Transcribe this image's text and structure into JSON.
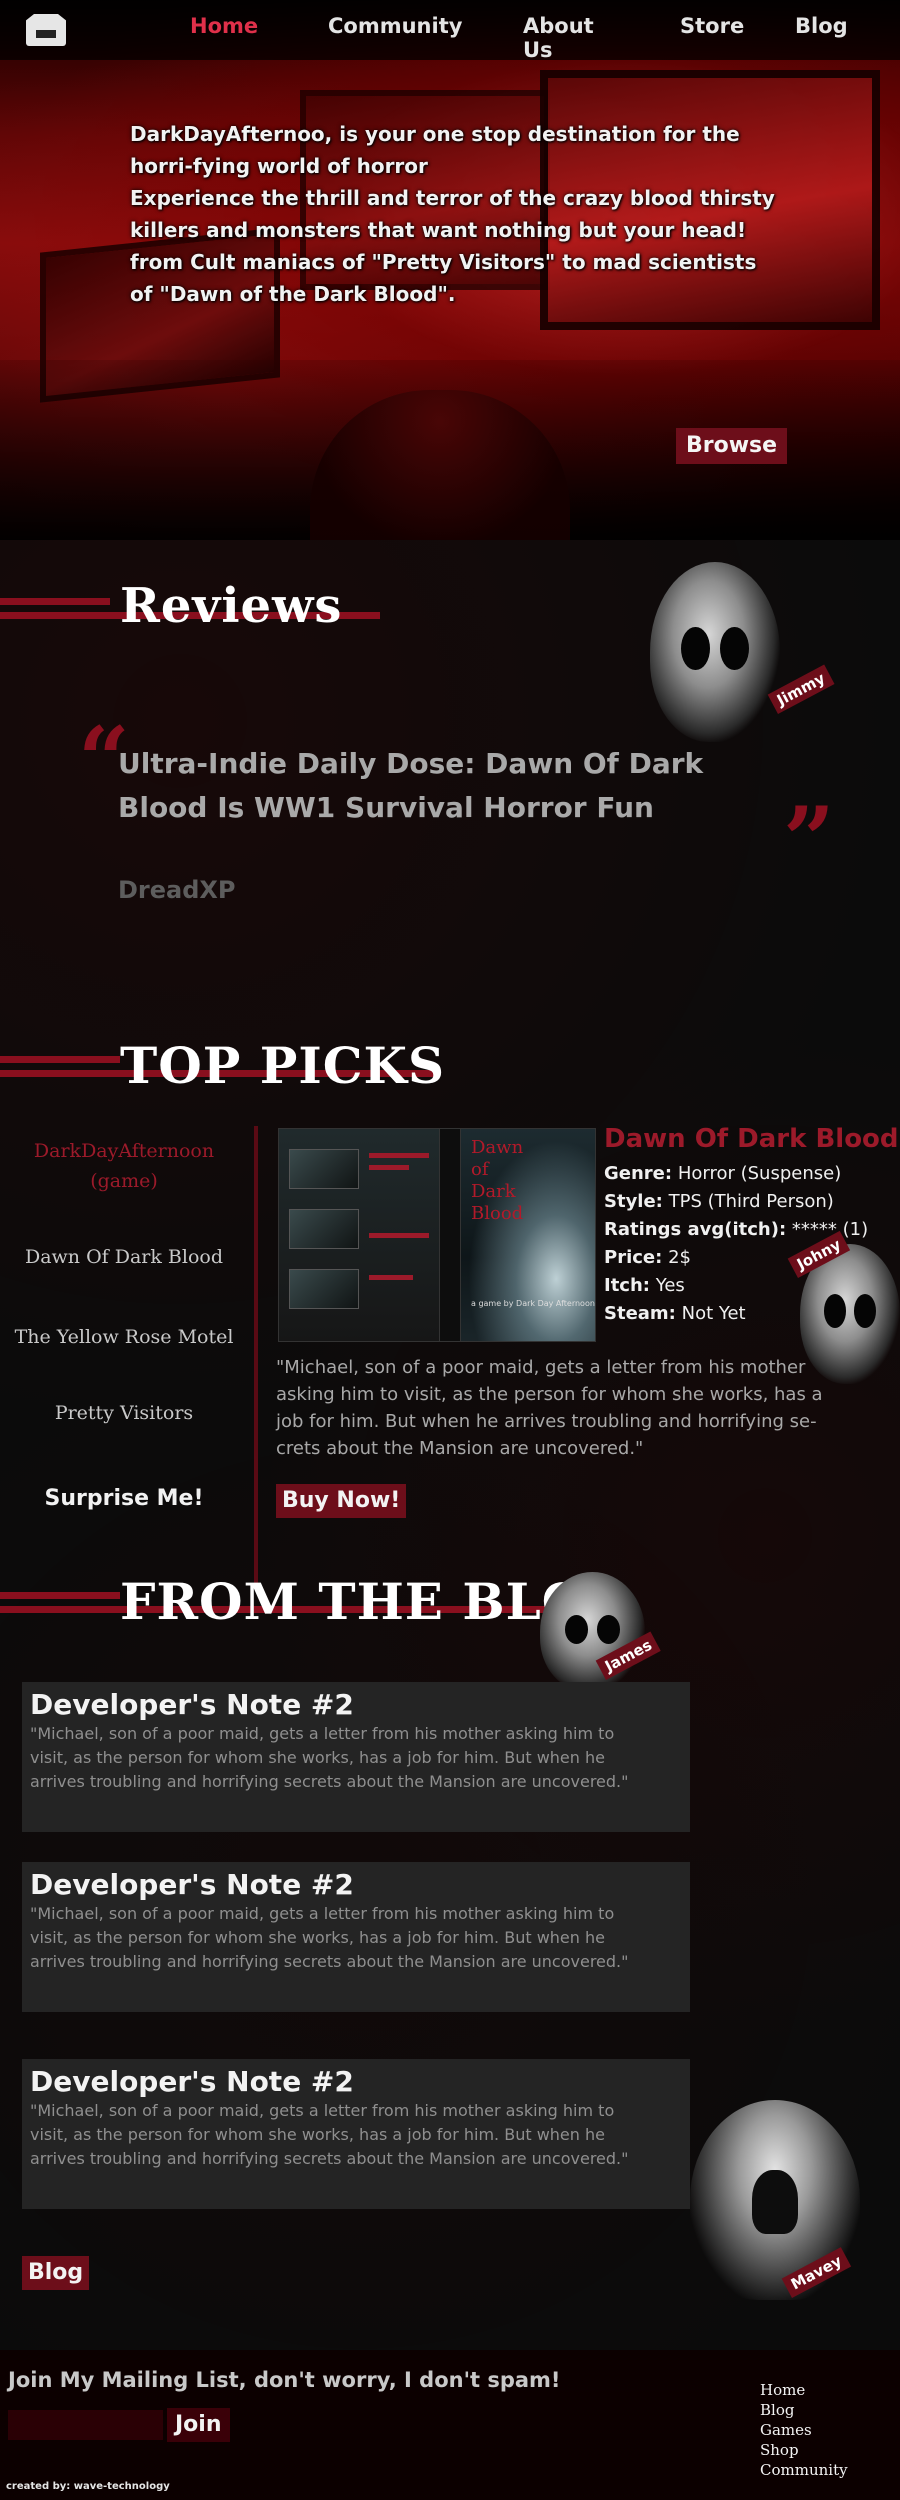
{
  "nav": {
    "items": [
      {
        "label": "Home",
        "active": true
      },
      {
        "label": "Community"
      },
      {
        "label": "About Us"
      },
      {
        "label": "Store"
      },
      {
        "label": "Blog"
      }
    ]
  },
  "hero": {
    "lines": [
      "DarkDayAfternoo, is your one stop destination for the horri-fying world of horror",
      "Experience the thrill and terror of the crazy blood thirsty killers and monsters that want nothing but your head! from Cult maniacs of \"Pretty Visitors\" to mad scientists of \"Dawn of the Dark Blood\"."
    ],
    "browse_label": "Browse"
  },
  "reviews": {
    "title": "Reviews",
    "skull_tag": "Jimmy",
    "open_quote": "“",
    "close_quote": "”",
    "headline": "Ultra-Indie Daily Dose: Dawn Of Dark Blood Is WW1 Survival Horror Fun",
    "source": "DreadXP"
  },
  "top_picks": {
    "title": "TOP PICKS",
    "skull_tag": "Johny",
    "list": [
      {
        "label": "DarkDayAfternoon (game)",
        "active": true
      },
      {
        "label": "Dawn Of Dark Blood"
      },
      {
        "label": "The Yellow Rose Motel"
      },
      {
        "label": "Pretty Visitors"
      },
      {
        "label": "Surprise Me!"
      }
    ],
    "cover": {
      "title": "Dawn of Dark Blood",
      "subtitle": "a game by Dark Day Afternoon"
    },
    "game": {
      "title": "Dawn Of Dark Blood",
      "info": [
        {
          "key": "Genre:",
          "value": "Horror (Suspense)"
        },
        {
          "key": "Style:",
          "value": "TPS (Third Person)"
        },
        {
          "key": "Ratings avg(itch):",
          "value": "***** (1)"
        },
        {
          "key": "Price:",
          "value": "2$"
        },
        {
          "key": "Itch:",
          "value": "Yes"
        },
        {
          "key": "Steam:",
          "value": "Not Yet"
        }
      ],
      "description": "\"Michael, son of a poor maid, gets a letter from his mother asking him to visit, as the person for whom she works, has a job for him. But when he arrives troubling and horrifying se-crets about the Mansion are uncovered.\"",
      "buy_label": "Buy Now!"
    }
  },
  "blog": {
    "title": "FROM THE BLOG",
    "skull_tag": "James",
    "ghost_tag": "Mavey",
    "posts": [
      {
        "title": "Developer's Note #2",
        "text": "\"Michael, son of a poor maid, gets a letter from his mother asking him to visit, as the person for whom she works, has a job for him. But when he arrives troubling and horrifying secrets about the Mansion are uncovered.\""
      },
      {
        "title": "Developer's Note #2",
        "text": "\"Michael, son of a poor maid, gets a letter from his mother asking him to visit, as the person for whom she works, has a job for him. But when he arrives troubling and horrifying secrets about the Mansion are uncovered.\""
      },
      {
        "title": "Developer's Note #2",
        "text": "\"Michael, son of a poor maid, gets a letter from his mother asking him to visit, as the person for whom she works, has a job for him. But when he arrives troubling and horrifying secrets about the Mansion are uncovered.\""
      }
    ],
    "blog_button": "Blog"
  },
  "footer": {
    "mailing_text": "Join My Mailing List, don't worry, I don't spam!",
    "email_value": "",
    "join_label": "Join",
    "links": [
      "Home",
      "Blog",
      "Games",
      "Shop",
      "Community"
    ],
    "credit": "created by: wave-technology"
  },
  "colors": {
    "accent": "#6d0e1a",
    "active_red": "#e0304a",
    "title_red": "#9c1a2a",
    "background": "#0a0a0a"
  }
}
